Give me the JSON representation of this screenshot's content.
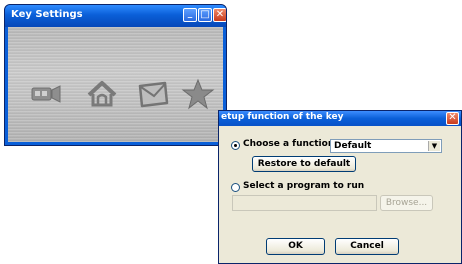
{
  "key_settings": {
    "title": "Key Settings",
    "controls": {
      "minimize": "_",
      "maximize": "□",
      "close": "✕"
    },
    "icons": [
      "media-icon",
      "home-icon",
      "mail-icon",
      "star-icon"
    ]
  },
  "setup_dialog": {
    "title": "etup function of the key",
    "close": "✕",
    "choose_function_label": "Choose a function",
    "choose_function_checked": true,
    "function_value": "Default",
    "restore_button": "Restore to default",
    "select_program_label": "Select a program to run",
    "select_program_checked": false,
    "program_path": "",
    "browse_button": "Browse...",
    "ok_button": "OK",
    "cancel_button": "Cancel"
  }
}
